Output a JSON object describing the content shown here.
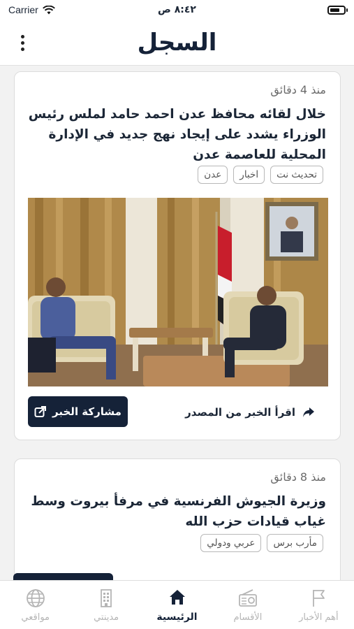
{
  "status_bar": {
    "carrier": "Carrier",
    "time": "٨:٤٢ ص"
  },
  "header": {
    "title": "السجل"
  },
  "articles": [
    {
      "time_ago": "منذ 4 دقائق",
      "headline": "خلال لقائه محافظ عدن احمد حامد لملس رئيس الوزراء يشدد على إيجاد نهج جديد في الإدارة المحلية للعاصمة عدن",
      "tags": [
        "تحديث نت",
        "اخبار",
        "عدن"
      ],
      "source_label": "اقرأ الخبر من المصدر",
      "share_label": "مشاركة الخبر"
    },
    {
      "time_ago": "منذ 8 دقائق",
      "headline": "وزيرة الجيوش الفرنسية في مرفأ بيروت وسط غياب قيادات حزب الله",
      "tags": [
        "مأرب برس",
        "عربي ودولي"
      ]
    }
  ],
  "tab_bar": {
    "items": [
      {
        "label": "مواقعي",
        "icon": "globe-icon",
        "active": false
      },
      {
        "label": "مدينتي",
        "icon": "building-icon",
        "active": false
      },
      {
        "label": "الرئيسية",
        "icon": "home-icon",
        "active": true
      },
      {
        "label": "الأقسام",
        "icon": "radio-icon",
        "active": false
      },
      {
        "label": "أهم الأخبار",
        "icon": "flag-icon",
        "active": false
      }
    ]
  },
  "colors": {
    "primary": "#152238",
    "inactive_tab": "#b5b5b5",
    "background": "#f2f2f2"
  }
}
